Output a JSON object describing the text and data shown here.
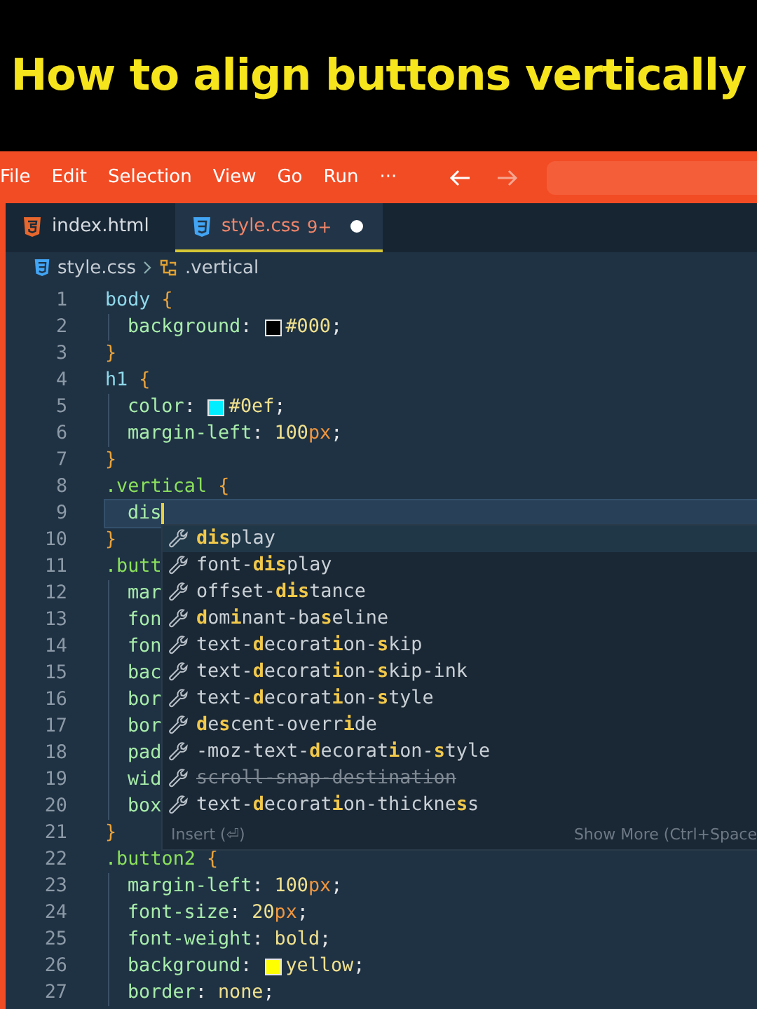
{
  "banner": {
    "title": "How to align buttons vertically"
  },
  "menu": [
    "File",
    "Edit",
    "Selection",
    "View",
    "Go",
    "Run",
    "···"
  ],
  "nav_buttons": [
    {
      "disabled": false
    },
    {
      "disabled": true
    }
  ],
  "tabs": [
    {
      "label": "index.html",
      "kind": "html",
      "selected": false
    },
    {
      "label": "style.css",
      "kind": "css",
      "selected": true,
      "badge": "9+",
      "modified": true
    }
  ],
  "breadcrumb": [
    {
      "label": "style.css",
      "kind": "css"
    },
    {
      "label": ".vertical",
      "kind": "symbol"
    }
  ],
  "lines": [
    {
      "number": "1",
      "indented": false,
      "tokens": [
        {
          "t": "body",
          "kind": "sel"
        },
        {
          "t": "{",
          "kind": "brace"
        }
      ]
    },
    {
      "number": "2",
      "indented": true,
      "tokens": [
        {
          "t": "background",
          "kind": "prop"
        },
        {
          "t": ":",
          "kind": "punct"
        },
        {
          "kind": "swatch",
          "color": "#000000"
        },
        {
          "t": "#000",
          "kind": "val"
        },
        {
          "t": ";",
          "kind": "end"
        }
      ]
    },
    {
      "number": "3",
      "indented": false,
      "tokens": [
        {
          "t": "}",
          "kind": "brace"
        }
      ]
    },
    {
      "number": "4",
      "indented": false,
      "tokens": [
        {
          "t": "h1",
          "kind": "sel"
        },
        {
          "t": "{",
          "kind": "brace"
        }
      ]
    },
    {
      "number": "5",
      "indented": true,
      "tokens": [
        {
          "t": "color",
          "kind": "prop"
        },
        {
          "t": ":",
          "kind": "punct"
        },
        {
          "kind": "swatch",
          "color": "#00eeff"
        },
        {
          "t": "#0ef",
          "kind": "val"
        },
        {
          "t": ";",
          "kind": "end"
        }
      ]
    },
    {
      "number": "6",
      "indented": true,
      "tokens": [
        {
          "t": "margin-left",
          "kind": "prop"
        },
        {
          "t": ":",
          "kind": "punct"
        },
        {
          "t": "100",
          "kind": "val"
        },
        {
          "t": "px",
          "kind": "unit"
        },
        {
          "t": ";",
          "kind": "end"
        }
      ]
    },
    {
      "number": "7",
      "indented": false,
      "tokens": [
        {
          "t": "}",
          "kind": "brace"
        }
      ]
    },
    {
      "number": "8",
      "indented": false,
      "tokens": [
        {
          "t": ".vertical",
          "kind": "cls"
        },
        {
          "t": "{",
          "kind": "brace"
        }
      ]
    },
    {
      "number": "9",
      "indented": true,
      "current": true,
      "tokens": [
        {
          "t": "dis",
          "kind": "prop"
        }
      ]
    },
    {
      "number": "10",
      "indented": false,
      "tokens": [
        {
          "t": "}",
          "kind": "brace"
        }
      ]
    },
    {
      "number": "11",
      "indented": false,
      "tokens": [
        {
          "t": ".butt",
          "kind": "cls"
        }
      ]
    },
    {
      "number": "12",
      "indented": true,
      "tokens": [
        {
          "t": "mar",
          "kind": "prop"
        }
      ]
    },
    {
      "number": "13",
      "indented": true,
      "tokens": [
        {
          "t": "fon",
          "kind": "prop"
        }
      ]
    },
    {
      "number": "14",
      "indented": true,
      "tokens": [
        {
          "t": "fon",
          "kind": "prop"
        }
      ]
    },
    {
      "number": "15",
      "indented": true,
      "tokens": [
        {
          "t": "bac",
          "kind": "prop"
        }
      ]
    },
    {
      "number": "16",
      "indented": true,
      "tokens": [
        {
          "t": "bor",
          "kind": "prop"
        }
      ]
    },
    {
      "number": "17",
      "indented": true,
      "tokens": [
        {
          "t": "bor",
          "kind": "prop"
        }
      ]
    },
    {
      "number": "18",
      "indented": true,
      "tokens": [
        {
          "t": "pad",
          "kind": "prop"
        }
      ]
    },
    {
      "number": "19",
      "indented": true,
      "tokens": [
        {
          "t": "wid",
          "kind": "prop"
        }
      ]
    },
    {
      "number": "20",
      "indented": true,
      "tokens": [
        {
          "t": "box",
          "kind": "prop"
        }
      ]
    },
    {
      "number": "21",
      "indented": false,
      "tokens": [
        {
          "t": "}",
          "kind": "brace"
        }
      ]
    },
    {
      "number": "22",
      "indented": false,
      "tokens": [
        {
          "t": ".button2",
          "kind": "cls"
        },
        {
          "t": "{",
          "kind": "brace"
        }
      ]
    },
    {
      "number": "23",
      "indented": true,
      "tokens": [
        {
          "t": "margin-left",
          "kind": "prop"
        },
        {
          "t": ":",
          "kind": "punct"
        },
        {
          "t": "100",
          "kind": "val"
        },
        {
          "t": "px",
          "kind": "unit"
        },
        {
          "t": ";",
          "kind": "end"
        }
      ]
    },
    {
      "number": "24",
      "indented": true,
      "tokens": [
        {
          "t": "font-size",
          "kind": "prop"
        },
        {
          "t": ":",
          "kind": "punct"
        },
        {
          "t": "20",
          "kind": "val"
        },
        {
          "t": "px",
          "kind": "unit"
        },
        {
          "t": ";",
          "kind": "end"
        }
      ]
    },
    {
      "number": "25",
      "indented": true,
      "tokens": [
        {
          "t": "font-weight",
          "kind": "prop"
        },
        {
          "t": ":",
          "kind": "punct"
        },
        {
          "t": "bold",
          "kind": "val"
        },
        {
          "t": ";",
          "kind": "end"
        }
      ]
    },
    {
      "number": "26",
      "indented": true,
      "tokens": [
        {
          "t": "background",
          "kind": "prop"
        },
        {
          "t": ":",
          "kind": "punct"
        },
        {
          "kind": "swatch",
          "color": "#ffff00"
        },
        {
          "t": "yellow",
          "kind": "val"
        },
        {
          "t": ";",
          "kind": "end"
        }
      ]
    },
    {
      "number": "27",
      "indented": true,
      "tokens": [
        {
          "t": "border",
          "kind": "prop"
        },
        {
          "t": ":",
          "kind": "punct"
        },
        {
          "t": "none",
          "kind": "val"
        },
        {
          "t": ";",
          "kind": "end"
        }
      ]
    }
  ],
  "suggestions": {
    "items": [
      {
        "label": "**dis**play",
        "selected": true,
        "deprecated": false
      },
      {
        "label": "font-**dis**play",
        "selected": false,
        "deprecated": false
      },
      {
        "label": "offset-**dis**tance",
        "selected": false,
        "deprecated": false
      },
      {
        "label": "**d**om**i**nant-ba**s**eline",
        "selected": false,
        "deprecated": false
      },
      {
        "label": "text-**d**ecorat**i**on-**s**kip",
        "selected": false,
        "deprecated": false
      },
      {
        "label": "text-**d**ecorat**i**on-**s**kip-ink",
        "selected": false,
        "deprecated": false
      },
      {
        "label": "text-**d**ecorat**i**on-**s**tyle",
        "selected": false,
        "deprecated": false
      },
      {
        "label": "**d**e**s**cent-overr**i**de",
        "selected": false,
        "deprecated": false
      },
      {
        "label": "-moz-text-**d**ecorat**i**on-**s**tyle",
        "selected": false,
        "deprecated": false
      },
      {
        "label": "scroll-snap-destination",
        "selected": false,
        "deprecated": true
      },
      {
        "label": "text-**d**ecorat**i**on-thickne**s**s",
        "selected": false,
        "deprecated": false
      }
    ],
    "footer_left": "Insert (⏎)",
    "footer_right": "Show More (Ctrl+Space"
  }
}
